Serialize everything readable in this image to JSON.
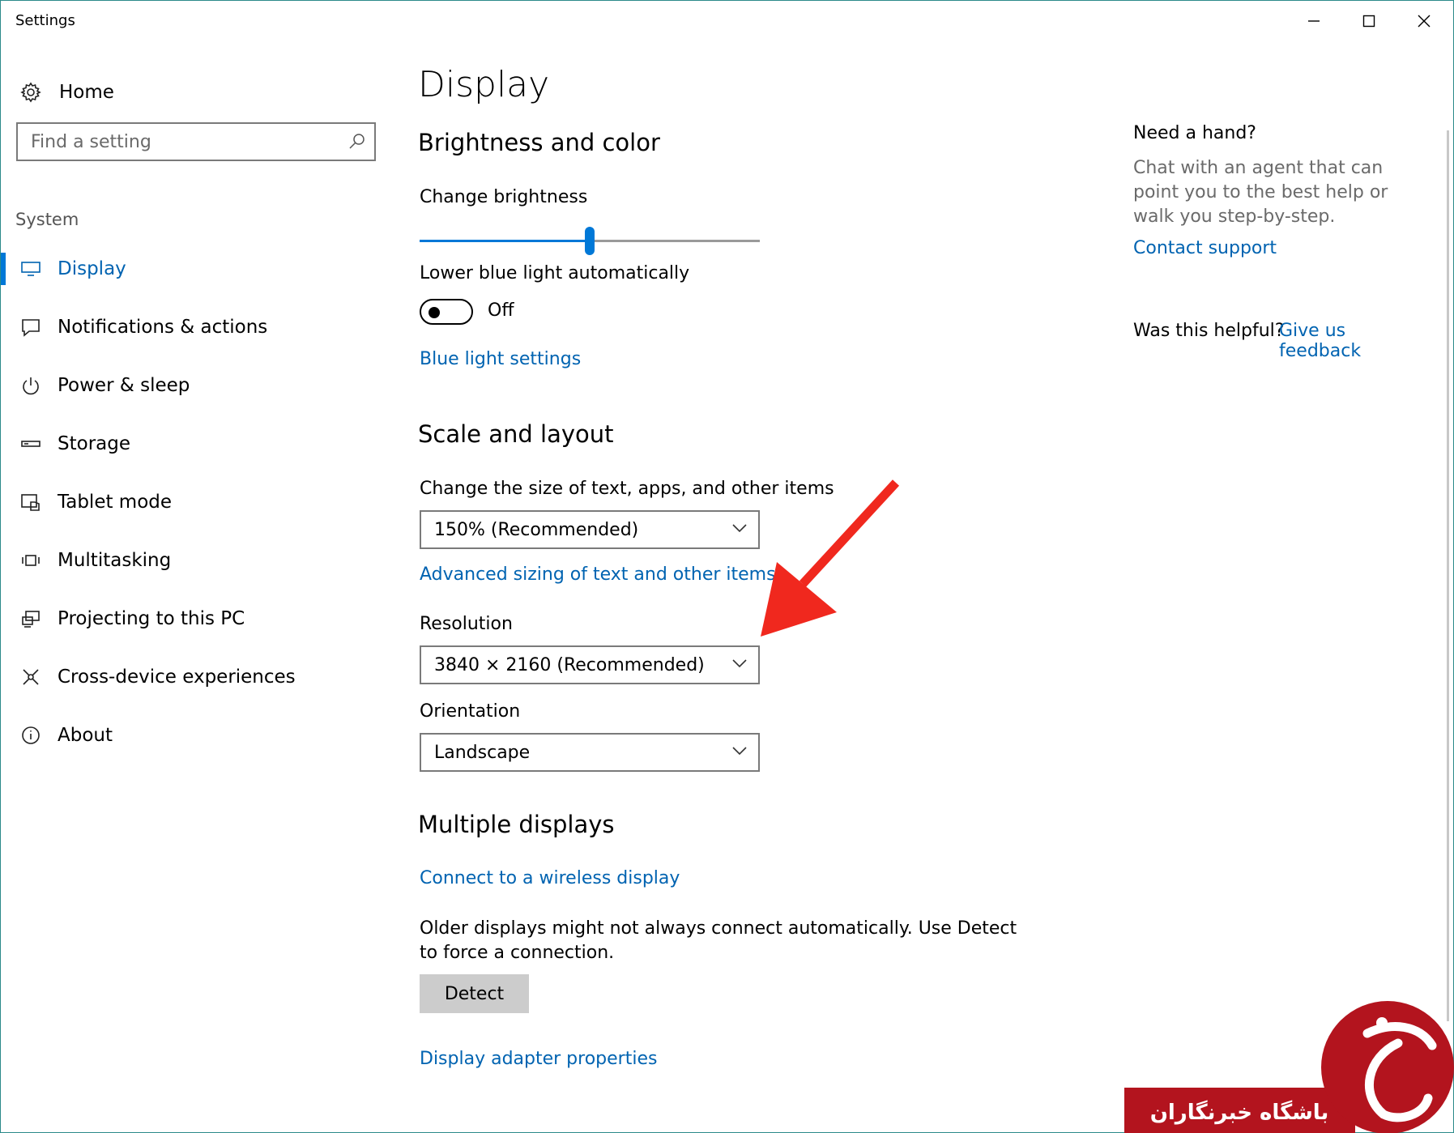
{
  "window": {
    "title": "Settings"
  },
  "sidebar": {
    "home_label": "Home",
    "search_placeholder": "Find a setting",
    "section_label": "System",
    "items": [
      {
        "label": "Display",
        "icon": "monitor-icon",
        "active": true
      },
      {
        "label": "Notifications & actions",
        "icon": "notification-icon",
        "active": false
      },
      {
        "label": "Power & sleep",
        "icon": "power-icon",
        "active": false
      },
      {
        "label": "Storage",
        "icon": "storage-icon",
        "active": false
      },
      {
        "label": "Tablet mode",
        "icon": "tablet-mode-icon",
        "active": false
      },
      {
        "label": "Multitasking",
        "icon": "multitasking-icon",
        "active": false
      },
      {
        "label": "Projecting to this PC",
        "icon": "projecting-icon",
        "active": false
      },
      {
        "label": "Cross-device experiences",
        "icon": "cross-device-icon",
        "active": false
      },
      {
        "label": "About",
        "icon": "info-icon",
        "active": false
      }
    ]
  },
  "main": {
    "title": "Display",
    "brightness_section": {
      "heading": "Brightness and color",
      "brightness_label": "Change brightness",
      "brightness_value": 0.5,
      "blue_light_label": "Lower blue light automatically",
      "blue_light_state": "Off",
      "blue_light_link": "Blue light settings"
    },
    "scale_section": {
      "heading": "Scale and layout",
      "scale_label": "Change the size of text, apps, and other items",
      "scale_value": "150% (Recommended)",
      "advanced_link": "Advanced sizing of text and other items",
      "resolution_label": "Resolution",
      "resolution_value": "3840 × 2160 (Recommended)",
      "orientation_label": "Orientation",
      "orientation_value": "Landscape"
    },
    "multiple_section": {
      "heading": "Multiple displays",
      "wireless_link": "Connect to a wireless display",
      "detect_text_line1": "Older displays might not always connect automatically. Use Detect",
      "detect_text_line2": "to force a connection.",
      "detect_button": "Detect",
      "adapter_link": "Display adapter properties"
    }
  },
  "aside": {
    "help_heading": "Need a hand?",
    "help_text": "Chat with an agent that can point you to the best help or walk you step-by-step.",
    "contact_link": "Contact support",
    "feedback_question": "Was this helpful?",
    "feedback_link": "Give us feedback"
  },
  "watermark": {
    "text": "باشگاه خبرنگاران"
  },
  "colors": {
    "accent": "#0078d7",
    "link": "#0063b1",
    "annotation_arrow": "#f0281e",
    "watermark": "#b3141e"
  }
}
